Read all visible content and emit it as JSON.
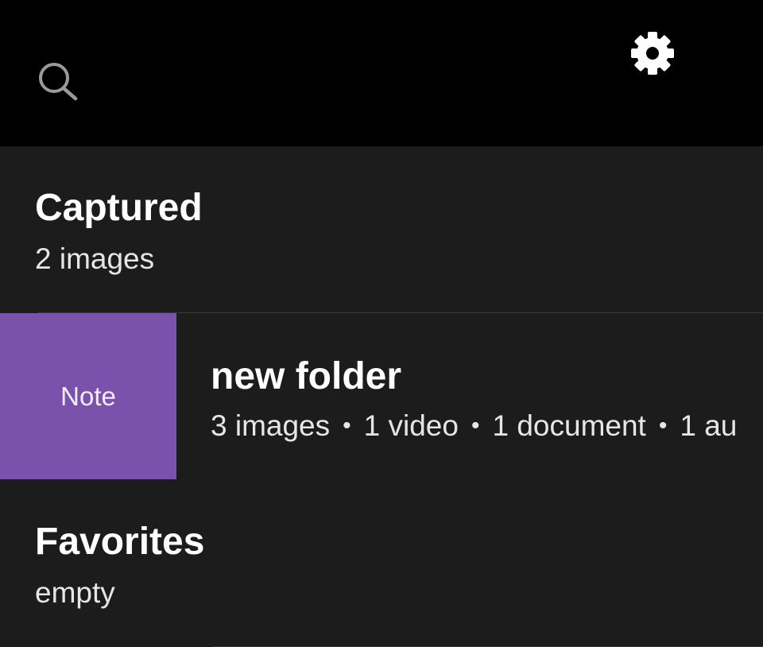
{
  "toolbar": {
    "search_icon": "search-icon",
    "settings_icon": "gear-icon"
  },
  "list": {
    "captured": {
      "title": "Captured",
      "subtitle": "2 images"
    },
    "folder": {
      "thumbnail_label": "Note",
      "thumbnail_color": "#7b52ab",
      "title": "new folder",
      "stats": [
        "3 images",
        "1 video",
        "1 document",
        "1 au"
      ]
    },
    "favorites": {
      "title": "Favorites",
      "subtitle": "empty"
    }
  },
  "colors": {
    "topbar_bg": "#000000",
    "list_bg": "#1c1c1c",
    "accent": "#7b52ab"
  }
}
